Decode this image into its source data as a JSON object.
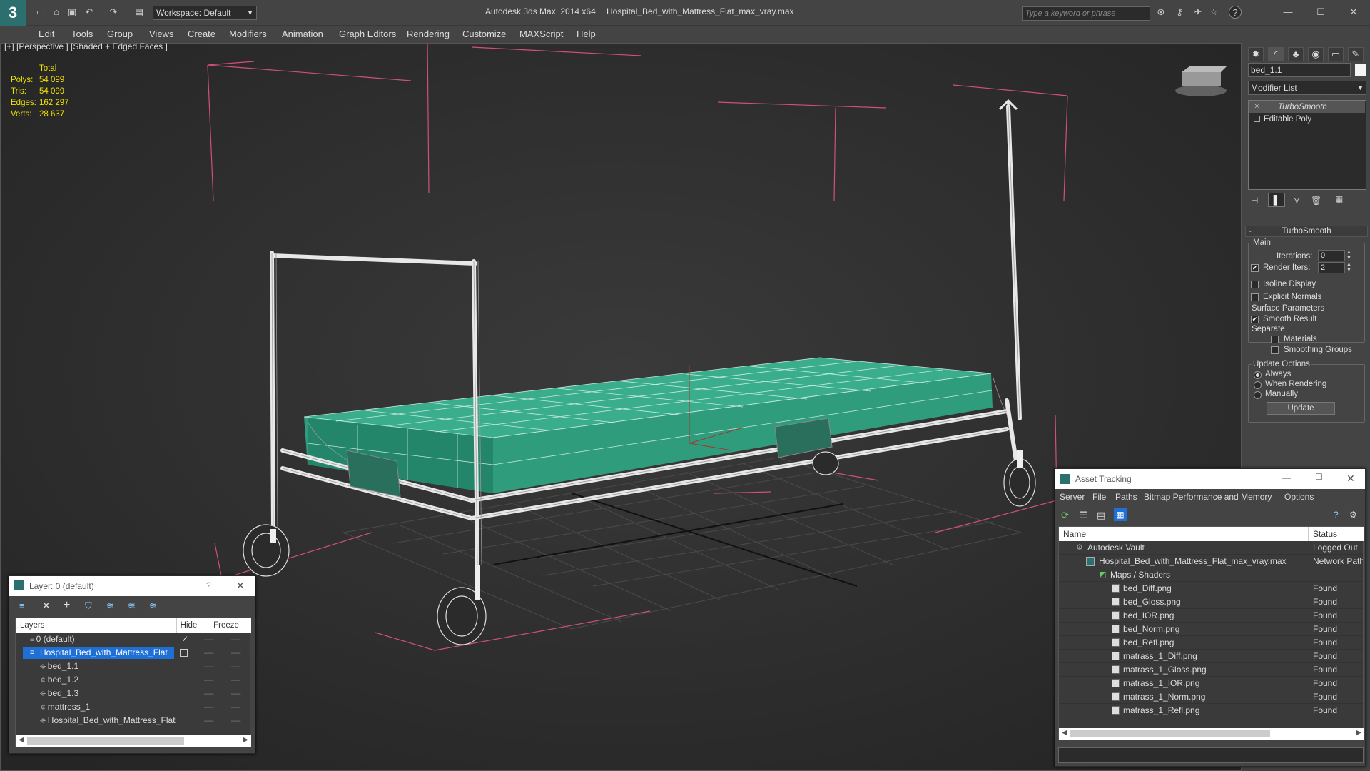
{
  "titlebar": {
    "app_title": "Autodesk 3ds Max  2014 x64",
    "file_title": "Hospital_Bed_with_Mattress_Flat_max_vray.max",
    "workspace": "Workspace: Default",
    "search_placeholder": "Type a keyword or phrase",
    "help": "?"
  },
  "menu": [
    "Edit",
    "Tools",
    "Group",
    "Views",
    "Create",
    "Modifiers",
    "Animation",
    "Graph Editors",
    "Rendering",
    "Customize",
    "MAXScript",
    "Help"
  ],
  "viewport": {
    "label": "[+] [Perspective ] [Shaded + Edged Faces ]",
    "stats": {
      "header": "Total",
      "rows": [
        {
          "label": "Polys:",
          "value": "54 099"
        },
        {
          "label": "Tris:",
          "value": "54 099"
        },
        {
          "label": "Edges:",
          "value": "162 297"
        },
        {
          "label": "Verts:",
          "value": "28 637"
        }
      ]
    }
  },
  "command_panel": {
    "object_name": "bed_1.1",
    "modifier_list": "Modifier List",
    "stack": [
      "TurboSmooth",
      "Editable Poly"
    ],
    "rollout_title": "TurboSmooth",
    "main_label": "Main",
    "iterations_label": "Iterations:",
    "iterations_value": "0",
    "render_iters_label": "Render Iters:",
    "render_iters_value": "2",
    "render_iters_checked": true,
    "isoline_display": "Isoline Display",
    "explicit_normals": "Explicit Normals",
    "surface_parameters": "Surface Parameters",
    "smooth_result": "Smooth Result",
    "separate": "Separate",
    "materials": "Materials",
    "smoothing_groups": "Smoothing Groups",
    "update_options": "Update Options",
    "always": "Always",
    "when_rendering": "When Rendering",
    "manually": "Manually",
    "update_button": "Update"
  },
  "layer_window": {
    "title": "Layer: 0 (default)",
    "help": "?",
    "columns": {
      "layers": "Layers",
      "hide": "Hide",
      "freeze": "Freeze"
    },
    "rows": [
      {
        "name": "0 (default)",
        "level": 1
      },
      {
        "name": "Hospital_Bed_with_Mattress_Flat",
        "level": 1,
        "selected": true
      },
      {
        "name": "bed_1.1",
        "level": 2
      },
      {
        "name": "bed_1.2",
        "level": 2
      },
      {
        "name": "bed_1.3",
        "level": 2
      },
      {
        "name": "mattress_1",
        "level": 2
      },
      {
        "name": "Hospital_Bed_with_Mattress_Flat",
        "level": 2
      }
    ]
  },
  "asset_window": {
    "title": "Asset Tracking",
    "menu": [
      "Server",
      "File",
      "Paths",
      "Bitmap Performance and Memory",
      "Options"
    ],
    "columns": {
      "name": "Name",
      "status": "Status"
    },
    "rows": [
      {
        "name": "Autodesk Vault",
        "status": "Logged Out ...",
        "level": 1
      },
      {
        "name": "Hospital_Bed_with_Mattress_Flat_max_vray.max",
        "status": "Network Path",
        "level": 2
      },
      {
        "name": "Maps / Shaders",
        "status": "",
        "level": 3
      },
      {
        "name": "bed_Diff.png",
        "status": "Found",
        "level": 4
      },
      {
        "name": "bed_Gloss.png",
        "status": "Found",
        "level": 4
      },
      {
        "name": "bed_IOR.png",
        "status": "Found",
        "level": 4
      },
      {
        "name": "bed_Norm.png",
        "status": "Found",
        "level": 4
      },
      {
        "name": "bed_Refl.png",
        "status": "Found",
        "level": 4
      },
      {
        "name": "matrass_1_Diff.png",
        "status": "Found",
        "level": 4
      },
      {
        "name": "matrass_1_Gloss.png",
        "status": "Found",
        "level": 4
      },
      {
        "name": "matrass_1_IOR.png",
        "status": "Found",
        "level": 4
      },
      {
        "name": "matrass_1_Norm.png",
        "status": "Found",
        "level": 4
      },
      {
        "name": "matrass_1_Refl.png",
        "status": "Found",
        "level": 4
      }
    ]
  },
  "colors": {
    "mattress": "#2a9a7a",
    "selection": "#1e6fd6",
    "stats": "#f0e000",
    "bbox": "#d0507a"
  }
}
